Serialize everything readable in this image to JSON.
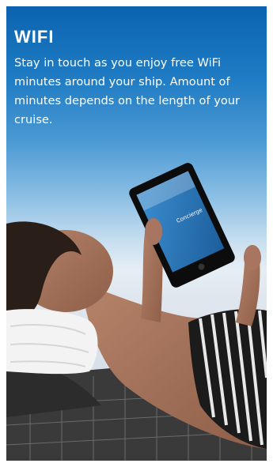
{
  "panel": {
    "title": "WIFI",
    "description": "Stay in touch as you enjoy free WiFi minutes around your ship. Amount of minutes depends on the length of your cruise."
  },
  "tablet_screen": {
    "app_name": "Concierge"
  },
  "colors": {
    "sky_top": "#0b63b0",
    "sky_bottom": "#e6eef5",
    "text": "#ffffff"
  }
}
